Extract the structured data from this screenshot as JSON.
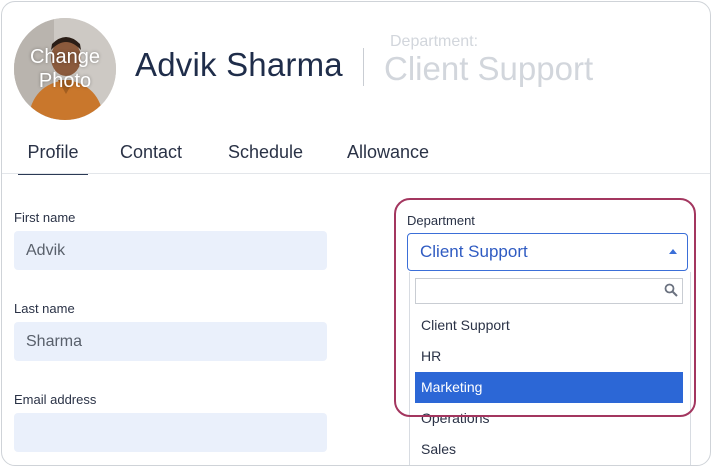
{
  "header": {
    "avatar_label": "Change Photo",
    "employee_name": "Advik Sharma",
    "department_caption": "Department:",
    "department_value": "Client Support"
  },
  "tabs": [
    {
      "label": "Profile",
      "active": true
    },
    {
      "label": "Contact",
      "active": false
    },
    {
      "label": "Schedule",
      "active": false
    },
    {
      "label": "Allowance",
      "active": false
    }
  ],
  "form": {
    "first_name_label": "First name",
    "first_name_value": "Advik",
    "last_name_label": "Last name",
    "last_name_value": "Sharma",
    "email_label": "Email address",
    "email_value": "",
    "department_label": "Department",
    "department_selected": "Client Support"
  },
  "dropdown": {
    "search_value": "",
    "options": [
      {
        "label": "Client Support",
        "highlighted": false
      },
      {
        "label": "HR",
        "highlighted": false
      },
      {
        "label": "Marketing",
        "highlighted": true
      },
      {
        "label": "Operations",
        "highlighted": false
      },
      {
        "label": "Sales",
        "highlighted": false
      }
    ]
  },
  "colors": {
    "accent": "#2c67d6",
    "highlight_border": "#a3365f",
    "input_bg": "#eaf0fb",
    "text_dark": "#1f2d4a"
  }
}
